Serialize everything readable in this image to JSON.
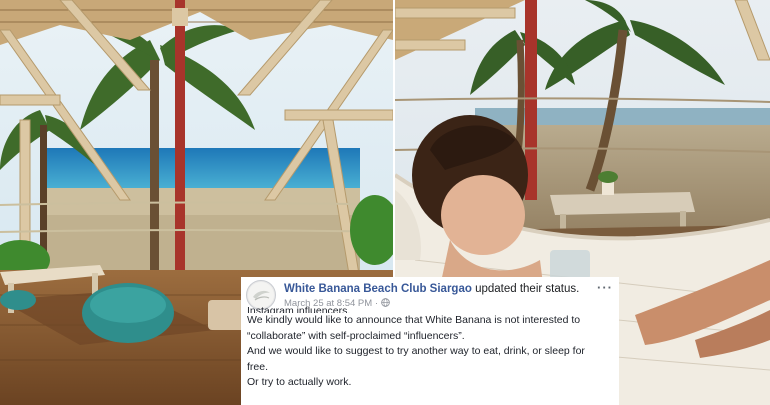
{
  "post": {
    "page_name": "White Banana Beach Club Siargao",
    "action_text": "updated their status.",
    "timestamp": "March 25 at 8:54 PM",
    "separator": "·",
    "more_menu": "···",
    "body_lines": [
      "Instagram influencers.",
      "We kindly would like to announce that White Banana is not interested to",
      "“collaborate” with self-proclaimed “influencers”.",
      "And we would like to suggest to try another way to eat, drink, or sleep for",
      "free.",
      "Or try to actually work."
    ]
  },
  "icons": {
    "privacy": "globe-icon",
    "menu": "more-options-icon"
  },
  "colors": {
    "page_name": "#385898",
    "meta": "#90949c",
    "body_text": "#1d2129"
  }
}
